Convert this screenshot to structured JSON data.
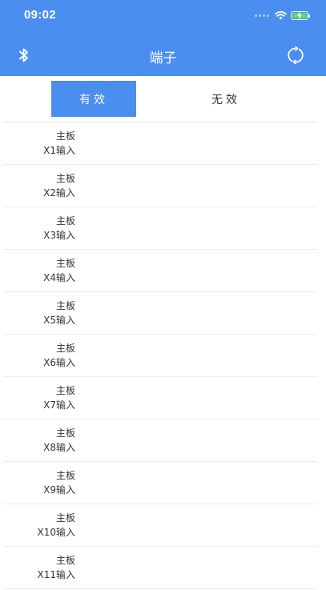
{
  "status_bar": {
    "time": "09:02"
  },
  "nav": {
    "title": "端子",
    "left_icon": "bluetooth-icon",
    "right_icon": "refresh-icon"
  },
  "tabs": [
    {
      "label": "有效",
      "selected": true
    },
    {
      "label": "无效",
      "selected": false
    }
  ],
  "colors": {
    "primary": "#4a8ef0",
    "battery": "#63d66b",
    "text": "#333333",
    "divider": "#ececec"
  },
  "list": {
    "items": [
      {
        "board": "主板",
        "terminal": "X1输入"
      },
      {
        "board": "主板",
        "terminal": "X2输入"
      },
      {
        "board": "主板",
        "terminal": "X3输入"
      },
      {
        "board": "主板",
        "terminal": "X4输入"
      },
      {
        "board": "主板",
        "terminal": "X5输入"
      },
      {
        "board": "主板",
        "terminal": "X6输入"
      },
      {
        "board": "主板",
        "terminal": "X7输入"
      },
      {
        "board": "主板",
        "terminal": "X8输入"
      },
      {
        "board": "主板",
        "terminal": "X9输入"
      },
      {
        "board": "主板",
        "terminal": "X10输入"
      },
      {
        "board": "主板",
        "terminal": "X11输入"
      }
    ]
  }
}
